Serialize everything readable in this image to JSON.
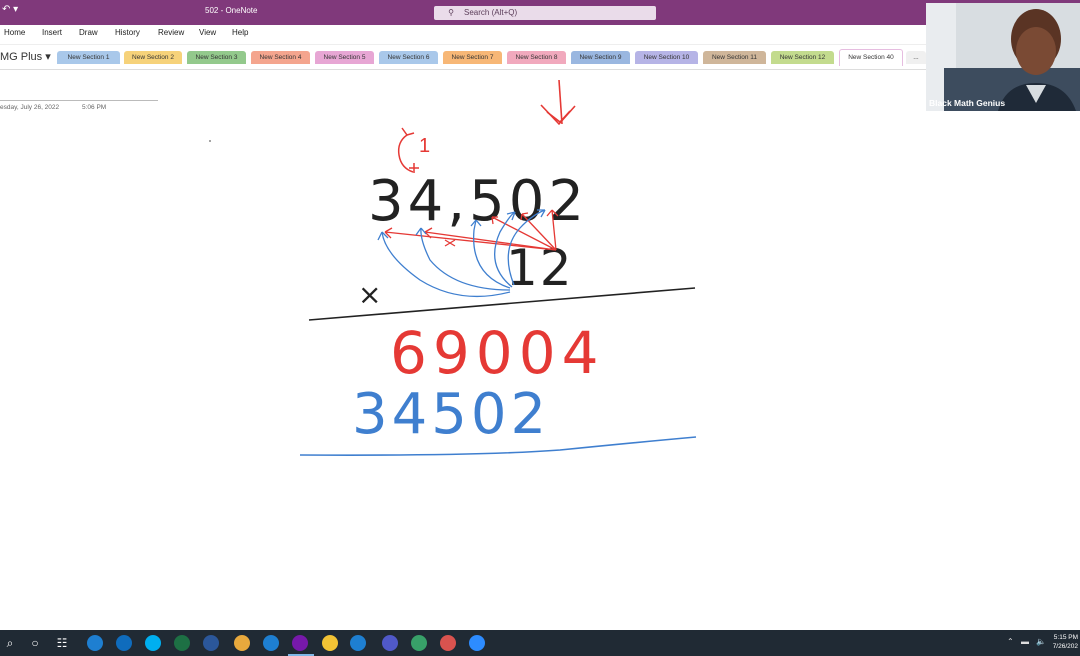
{
  "window": {
    "title": "502  -  OneNote",
    "quick_access": "↶  ▾",
    "search_placeholder": "Search (Alt+Q)"
  },
  "ribbon_menu": [
    "Home",
    "Insert",
    "Draw",
    "History",
    "Review",
    "View",
    "Help"
  ],
  "notebook": {
    "name": "MG Plus",
    "dropdown": "▾"
  },
  "sections": [
    {
      "label": "New Section 1",
      "color": "#a9c8ea"
    },
    {
      "label": "New Section 2",
      "color": "#f6d27a"
    },
    {
      "label": "New Section 3",
      "color": "#93c98c"
    },
    {
      "label": "New Section 4",
      "color": "#f4a58e"
    },
    {
      "label": "New Section 5",
      "color": "#e7a6d4"
    },
    {
      "label": "New Section 6",
      "color": "#a9c8ea"
    },
    {
      "label": "New Section 7",
      "color": "#f7b776"
    },
    {
      "label": "New Section 8",
      "color": "#f1a9bd"
    },
    {
      "label": "New Section 9",
      "color": "#9ab7e0"
    },
    {
      "label": "New Section 10",
      "color": "#b6b4e6"
    },
    {
      "label": "New Section 11",
      "color": "#cfb69a"
    },
    {
      "label": "New Section 12",
      "color": "#c3db8e"
    },
    {
      "label": "New Section 40",
      "color": "#ffffff",
      "active": true
    },
    {
      "label": "...",
      "color": "#f0f0f0"
    }
  ],
  "page": {
    "date": "esday, July 26, 2022",
    "time": "5:06 PM"
  },
  "ink": {
    "top_number": "34,502",
    "multiplier": "12",
    "operator": "×",
    "carry": "1",
    "partial_1": "69004",
    "partial_2": "34502"
  },
  "webcam": {
    "label": "Black Math Genius"
  },
  "taskbar": {
    "time": "5:15 PM",
    "date": "7/26/202",
    "icons": [
      "search-icon",
      "cortana-icon",
      "task-view-icon",
      "ie-icon",
      "outlook-icon",
      "skype-icon",
      "excel-icon",
      "word-icon",
      "chrome-icon",
      "edge-icon",
      "onenote-icon",
      "file-explorer-icon",
      "edge-legacy-icon",
      "teams-icon",
      "maps-icon",
      "eraser-app-icon",
      "zoom-icon"
    ],
    "colors": {
      "excel": "#1d7044",
      "word": "#2b579a",
      "onenote": "#7719aa",
      "chrome": "#e8a93d",
      "edge": "#1e7fd1",
      "skype": "#00aff0",
      "outlook": "#0f6cbd",
      "teams": "#5059c9",
      "zoom": "#2d8cff"
    }
  }
}
